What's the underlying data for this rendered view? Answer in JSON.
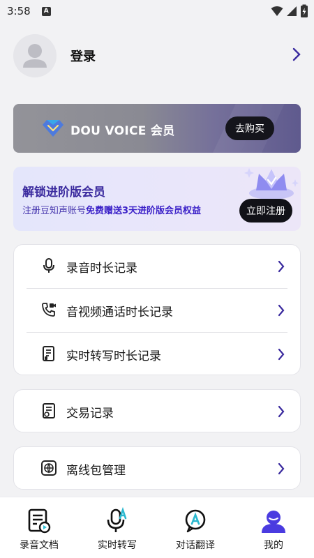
{
  "status_bar": {
    "time": "3:58",
    "notif_badge": "A"
  },
  "profile": {
    "login_label": "登录"
  },
  "vip_banner": {
    "title": "DOU VOICE 会员",
    "buy_label": "去购买"
  },
  "promo": {
    "title": "解锁进阶版会员",
    "subtitle_prefix": "注册豆知声账号",
    "subtitle_highlight": "免费赠送3天进阶版会员权益",
    "button_label": "立即注册"
  },
  "menu": {
    "group1": [
      {
        "label": "录音时长记录",
        "icon": "microphone-icon"
      },
      {
        "label": "音视频通话时长记录",
        "icon": "phone-video-icon"
      },
      {
        "label": "实时转写时长记录",
        "icon": "transcript-doc-icon"
      }
    ],
    "group2": [
      {
        "label": "交易记录",
        "icon": "receipt-icon"
      }
    ],
    "group3": [
      {
        "label": "离线包管理",
        "icon": "globe-package-icon"
      }
    ]
  },
  "tabs": [
    {
      "label": "录音文档",
      "icon": "recording-doc-icon"
    },
    {
      "label": "实时转写",
      "icon": "realtime-transcribe-icon"
    },
    {
      "label": "对话翻译",
      "icon": "dialog-translate-icon"
    },
    {
      "label": "我的",
      "icon": "profile-icon"
    }
  ],
  "colors": {
    "accent": "#3b21c8",
    "chevron": "#3a2a9e",
    "tab_active": "#4a3be0"
  }
}
